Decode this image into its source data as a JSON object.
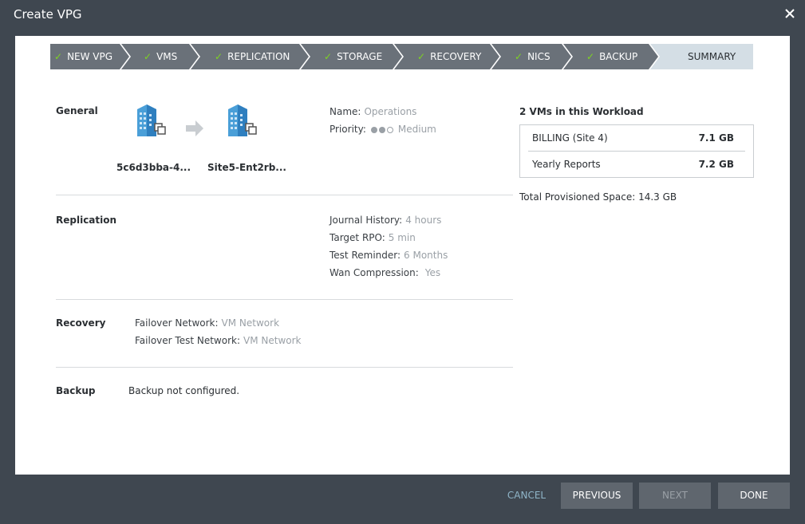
{
  "window": {
    "title": "Create VPG",
    "close_icon": "close-icon"
  },
  "wizard": {
    "steps": [
      {
        "label": "NEW VPG",
        "done": true
      },
      {
        "label": "VMS",
        "done": true
      },
      {
        "label": "REPLICATION",
        "done": true
      },
      {
        "label": "STORAGE",
        "done": true
      },
      {
        "label": "RECOVERY",
        "done": true
      },
      {
        "label": "NICS",
        "done": true
      },
      {
        "label": "BACKUP",
        "done": true
      },
      {
        "label": "SUMMARY",
        "done": false,
        "active": true
      }
    ],
    "check_glyph": "✓",
    "colors": {
      "done": "#6a7179",
      "active": "#d4dee5",
      "check": "#7ed321"
    }
  },
  "general": {
    "title": "General",
    "source_site": "5c6d3bba-4...",
    "target_site": "Site5-Ent2rb...",
    "name_label": "Name:",
    "name_value": "Operations",
    "priority_label": "Priority:",
    "priority_value": "Medium",
    "priority_level": 2,
    "priority_max": 3
  },
  "workload": {
    "title": "2 VMs in this Workload",
    "vms": [
      {
        "name": "BILLING (Site 4)",
        "size": "7.1 GB"
      },
      {
        "name": "Yearly Reports",
        "size": "7.2 GB"
      }
    ],
    "total": "Total Provisioned Space: 14.3 GB"
  },
  "replication": {
    "title": "Replication",
    "journal_label": "Journal History:",
    "journal_value": "4 hours",
    "rpo_label": "Target RPO:",
    "rpo_value": "5 min",
    "reminder_label": "Test Reminder:",
    "reminder_value": "6 Months",
    "wan_label": "Wan Compression:",
    "wan_value": "Yes"
  },
  "recovery": {
    "title": "Recovery",
    "failover_label": "Failover Network:",
    "failover_value": "VM Network",
    "test_label": "Failover Test Network:",
    "test_value": "VM Network"
  },
  "backup": {
    "title": "Backup",
    "text": "Backup not configured."
  },
  "footer": {
    "cancel": "CANCEL",
    "previous": "PREVIOUS",
    "next": "NEXT",
    "done": "DONE"
  }
}
